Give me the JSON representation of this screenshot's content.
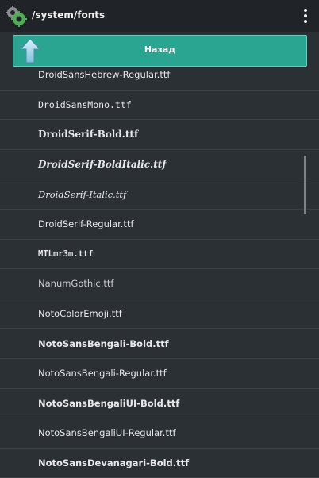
{
  "header": {
    "path": "/system/fonts",
    "app_icon": "gear-cog-app-icon",
    "menu_icon": "overflow-menu-icon"
  },
  "back_button": {
    "label": "Назад",
    "icon": "arrow-up-icon",
    "color": "#2aa591"
  },
  "files": [
    {
      "name": "DroidSansHebrew-Regular.ttf",
      "style": "sans"
    },
    {
      "name": "DroidSansMono.ttf",
      "style": "mono"
    },
    {
      "name": "DroidSerif-Bold.ttf",
      "style": "serifbold"
    },
    {
      "name": "DroidSerif-BoldItalic.ttf",
      "style": "serifbolditalic"
    },
    {
      "name": "DroidSerif-Italic.ttf",
      "style": "serifitalic"
    },
    {
      "name": "DroidSerif-Regular.ttf",
      "style": "sans"
    },
    {
      "name": "MTLmr3m.ttf",
      "style": "monobold"
    },
    {
      "name": "NanumGothic.ttf",
      "style": "light"
    },
    {
      "name": "NotoColorEmoji.ttf",
      "style": "sans"
    },
    {
      "name": "NotoSansBengali-Bold.ttf",
      "style": "sansbold"
    },
    {
      "name": "NotoSansBengali-Regular.ttf",
      "style": "sans"
    },
    {
      "name": "NotoSansBengaliUI-Bold.ttf",
      "style": "sansbold"
    },
    {
      "name": "NotoSansBengaliUI-Regular.ttf",
      "style": "sans"
    },
    {
      "name": "NotoSansDevanagari-Bold.ttf",
      "style": "sansbold"
    }
  ]
}
